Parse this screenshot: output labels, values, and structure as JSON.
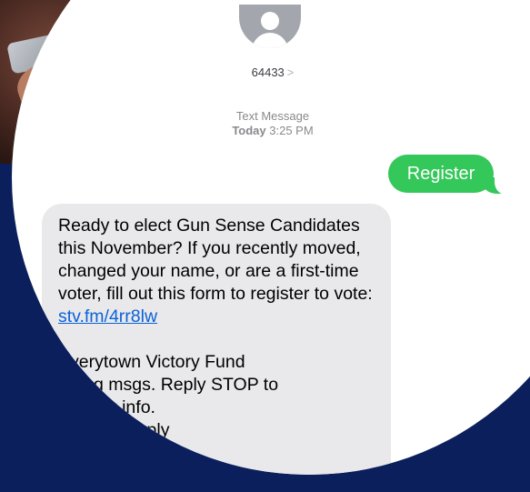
{
  "conversation": {
    "sender": "64433",
    "sender_chevron": ">",
    "message_type": "Text Message",
    "day": "Today",
    "time": "3:25 PM"
  },
  "sent": {
    "text": "Register"
  },
  "received": {
    "body": "Ready to elect Gun Sense Candidates this November? If you recently moved, changed your name, or are a first-time voter, fill out this form to register to vote:",
    "link": "stv.fm/4rr8lw",
    "footer_line1": "Everytown Victory Fund",
    "footer_line2": "urring msgs. Reply STOP to",
    "footer_line3": "ELP for info.",
    "footer_line4": "atesMayApply"
  },
  "colors": {
    "background": "#0b1f5c",
    "sent_bubble": "#34c759",
    "received_bubble": "#e9e9eb",
    "link": "#0a62d8"
  }
}
